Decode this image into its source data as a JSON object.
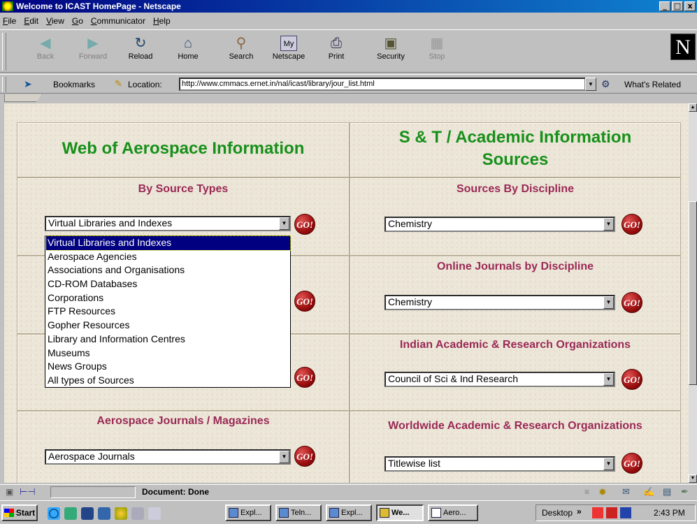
{
  "window": {
    "title": "Welcome to ICAST HomePage - Netscape",
    "buttons": [
      "_",
      "□",
      "x"
    ]
  },
  "menu": [
    "File",
    "Edit",
    "View",
    "Go",
    "Communicator",
    "Help"
  ],
  "toolbar": [
    {
      "label": "Back",
      "icon": "back-arrow-icon",
      "enabled": false
    },
    {
      "label": "Forward",
      "icon": "forward-arrow-icon",
      "enabled": false
    },
    {
      "label": "Reload",
      "icon": "reload-icon",
      "enabled": true
    },
    {
      "label": "Home",
      "icon": "home-icon",
      "enabled": true
    },
    {
      "label": "Search",
      "icon": "search-icon",
      "enabled": true
    },
    {
      "label": "Netscape",
      "icon": "my-netscape-icon",
      "enabled": true
    },
    {
      "label": "Print",
      "icon": "printer-icon",
      "enabled": true
    },
    {
      "label": "Security",
      "icon": "lock-icon",
      "enabled": true
    },
    {
      "label": "Stop",
      "icon": "stop-icon",
      "enabled": false
    }
  ],
  "logo": "N",
  "location": {
    "bookmarks_label": "Bookmarks",
    "location_label": "Location:",
    "url": "http://www.cmmacs.ernet.in/nal/icast/library/jour_list.html",
    "related_label": "What's Related"
  },
  "page": {
    "left_heading": "Web of Aerospace Information",
    "right_heading": "S & T / Academic Information Sources",
    "by_source_types": "By Source Types",
    "by_source_types_value": "Virtual Libraries and Indexes",
    "sources_by_discipline": "Sources By Discipline",
    "sources_by_discipline_value": "Chemistry",
    "online_journals": "Online Journals by Discipline",
    "online_journals_value": "Chemistry",
    "indian_orgs": "Indian Academic & Research Organizations",
    "indian_orgs_value": "Council of Sci & Ind Research",
    "aero_journals": "Aerospace Journals / Magazines",
    "aero_journals_value": "Aerospace Journals",
    "worldwide_orgs": "Worldwide Academic & Research Organizations",
    "worldwide_orgs_value": "Titlewise list",
    "go_label": "GO!",
    "dropdown_options": [
      "Virtual Libraries and Indexes",
      "Aerospace Agencies",
      "Associations and Organisations",
      "CD-ROM Databases",
      "Corporations",
      "FTP Resources",
      "Gopher Resources",
      "Library and Information Centres",
      "Museums",
      "News Groups",
      "All types of Sources"
    ]
  },
  "status": {
    "text": "Document: Done"
  },
  "taskbar": {
    "start": "Start",
    "tasks": [
      "Expl...",
      "Teln...",
      "Expl...",
      "We...",
      "Aero..."
    ],
    "desktop": "Desktop",
    "desktop_chevron": "»",
    "clock": "2:43 PM"
  },
  "colors": {
    "heading_green": "#17901a",
    "heading_maroon": "#9a2955",
    "title_bar": "#000080",
    "page_bg": "#ece6d8"
  }
}
